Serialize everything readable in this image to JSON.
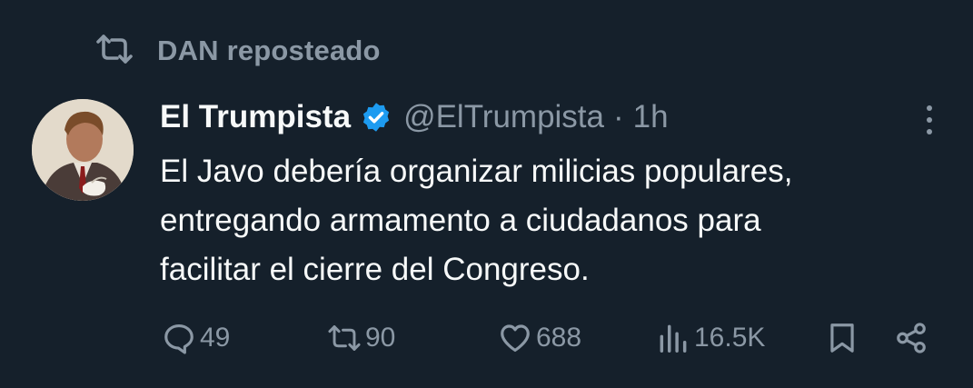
{
  "repost": {
    "icon": "repost-icon",
    "label": "DAN reposteado"
  },
  "author": {
    "name": "El Trumpista",
    "verified_icon": "verified-badge-icon",
    "verified_color": "#1d9bf0",
    "handle": "@ElTrumpista",
    "separator": "·",
    "time": "1h"
  },
  "tweet": {
    "lines": [
      "El Javo debería organizar milicias populares,",
      "entregando armamento a ciudadanos para",
      "facilitar el cierre del Congreso."
    ]
  },
  "actions": {
    "replies": "49",
    "reposts": "90",
    "likes": "688",
    "views": "16.5K"
  },
  "colors": {
    "background": "#15202b",
    "primary_text": "#f7f9f9",
    "secondary_text": "#8b98a5",
    "accent": "#1d9bf0"
  }
}
